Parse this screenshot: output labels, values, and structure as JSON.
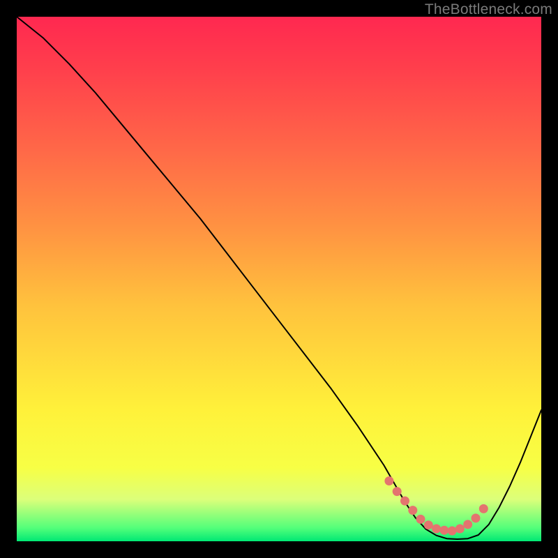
{
  "attribution": "TheBottleneck.com",
  "chart_data": {
    "type": "line",
    "title": "",
    "xlabel": "",
    "ylabel": "",
    "xlim": [
      0,
      100
    ],
    "ylim": [
      0,
      100
    ],
    "series": [
      {
        "name": "bottleneck-curve",
        "x": [
          0,
          5,
          10,
          15,
          20,
          25,
          30,
          35,
          40,
          45,
          50,
          55,
          60,
          65,
          70,
          72,
          74,
          76,
          78,
          80,
          82,
          84,
          86,
          88,
          90,
          92,
          94,
          96,
          98,
          100
        ],
        "values": [
          100,
          96,
          91,
          85.5,
          79.5,
          73.5,
          67.5,
          61.5,
          55,
          48.5,
          42,
          35.5,
          29,
          22,
          14.5,
          11,
          7.5,
          4.5,
          2.3,
          1.1,
          0.5,
          0.4,
          0.5,
          1.2,
          3.2,
          6.5,
          10.5,
          15,
          20,
          25
        ]
      }
    ],
    "highlight_region": {
      "name": "valley-dots",
      "x": [
        71,
        72.5,
        74,
        75.5,
        77,
        78.5,
        80,
        81.5,
        83,
        84.5,
        86,
        87.5,
        89
      ],
      "values": [
        11.5,
        9.5,
        7.7,
        5.9,
        4.2,
        3.1,
        2.4,
        2.1,
        2.0,
        2.4,
        3.2,
        4.4,
        6.2
      ]
    },
    "background": {
      "type": "vertical-gradient",
      "stops": [
        {
          "pct": 0,
          "color": "#ff2850"
        },
        {
          "pct": 25,
          "color": "#ff6748"
        },
        {
          "pct": 55,
          "color": "#ffc23d"
        },
        {
          "pct": 86,
          "color": "#f7ff45"
        },
        {
          "pct": 100,
          "color": "#00e874"
        }
      ]
    }
  }
}
